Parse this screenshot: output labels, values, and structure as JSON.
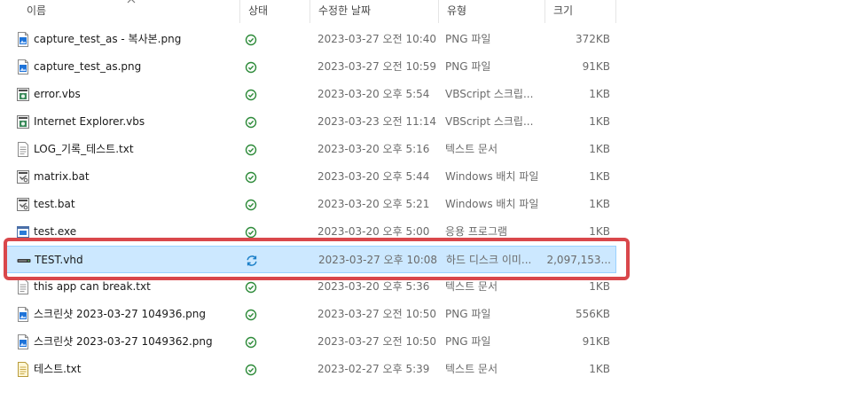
{
  "columns": {
    "name": "이름",
    "status": "상태",
    "date": "수정한 날짜",
    "type": "유형",
    "size": "크기"
  },
  "files": [
    {
      "name": "capture_test_as - 복사본.png",
      "date": "2023-03-27 오전 10:40",
      "type": "PNG 파일",
      "size": "372KB",
      "icon": "image-file-icon",
      "status": "synced-check-icon"
    },
    {
      "name": "capture_test_as.png",
      "date": "2023-03-27 오전 10:59",
      "type": "PNG 파일",
      "size": "91KB",
      "icon": "image-file-icon",
      "status": "synced-check-icon"
    },
    {
      "name": "error.vbs",
      "date": "2023-03-20 오후 5:54",
      "type": "VBScript 스크립...",
      "size": "1KB",
      "icon": "script-file-icon",
      "status": "synced-check-icon"
    },
    {
      "name": "Internet Explorer.vbs",
      "date": "2023-03-23 오전 11:14",
      "type": "VBScript 스크립...",
      "size": "1KB",
      "icon": "script-file-icon",
      "status": "synced-check-icon"
    },
    {
      "name": "LOG_기록_테스트.txt",
      "date": "2023-03-20 오후 5:16",
      "type": "텍스트 문서",
      "size": "1KB",
      "icon": "text-file-icon",
      "status": "synced-check-icon"
    },
    {
      "name": "matrix.bat",
      "date": "2023-03-20 오후 5:44",
      "type": "Windows 배치 파일",
      "size": "1KB",
      "icon": "batch-file-icon",
      "status": "synced-check-icon"
    },
    {
      "name": "test.bat",
      "date": "2023-03-20 오후 5:21",
      "type": "Windows 배치 파일",
      "size": "1KB",
      "icon": "batch-file-icon",
      "status": "synced-check-icon"
    },
    {
      "name": "test.exe",
      "date": "2023-03-20 오후 5:00",
      "type": "응용 프로그램",
      "size": "1KB",
      "icon": "application-file-icon",
      "status": "synced-check-icon"
    },
    {
      "name": "TEST.vhd",
      "date": "2023-03-27 오후 10:08",
      "type": "하드 디스크 이미...",
      "size": "2,097,153...",
      "icon": "disk-image-file-icon",
      "status": "syncing-icon",
      "selected": true
    },
    {
      "name": "this app can break.txt",
      "date": "2023-03-20 오후 5:36",
      "type": "텍스트 문서",
      "size": "1KB",
      "icon": "text-file-icon",
      "status": "synced-check-icon"
    },
    {
      "name": "스크린샷 2023-03-27 104936.png",
      "date": "2023-03-27 오전 10:50",
      "type": "PNG 파일",
      "size": "556KB",
      "icon": "image-file-icon",
      "status": "synced-check-icon"
    },
    {
      "name": "스크린샷 2023-03-27 1049362.png",
      "date": "2023-03-27 오전 10:50",
      "type": "PNG 파일",
      "size": "91KB",
      "icon": "image-file-icon",
      "status": "synced-check-icon"
    },
    {
      "name": "테스트.txt",
      "date": "2023-02-27 오후 5:39",
      "type": "텍스트 문서",
      "size": "1KB",
      "icon": "note-file-icon",
      "status": "synced-check-icon"
    }
  ],
  "colors": {
    "selection_bg": "#cce8ff",
    "selection_border": "#99d1ff",
    "sync_green": "#2e8b3a",
    "highlight_red": "#d9474b"
  }
}
